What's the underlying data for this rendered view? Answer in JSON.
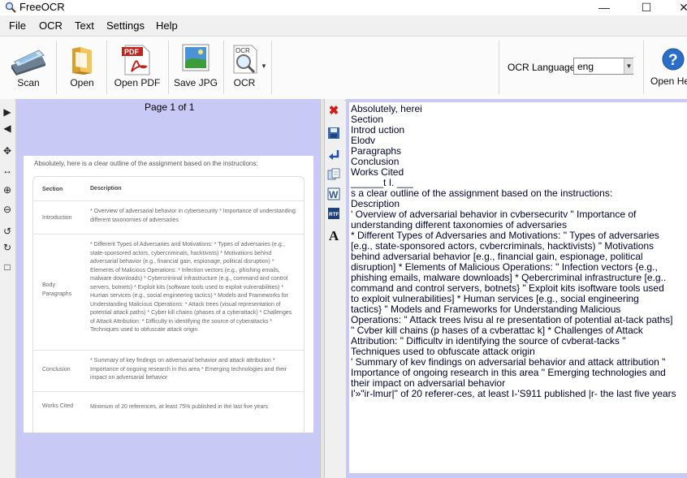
{
  "window": {
    "title": "FreeOCR"
  },
  "menu": [
    "File",
    "OCR",
    "Text",
    "Settings",
    "Help"
  ],
  "toolbar": {
    "scan": "Scan",
    "open": "Open",
    "open_pdf": "Open PDF",
    "save_jpg": "Save JPG",
    "ocr": "OCR",
    "ocr_language_label": "OCR Language:",
    "ocr_language_value": "eng",
    "open_help": "Open He"
  },
  "image_pane": {
    "page_indicator": "Page 1 of 1"
  },
  "document_image": {
    "intro": "Absolutely, here is a clear outline of the assignment based on the instructions:",
    "header": {
      "section": "Section",
      "description": "Description"
    },
    "rows": [
      {
        "section": "Introduction",
        "description": "* Overview of adversarial behavior in cybersecurity * Importance of understanding different taxonomies of adversaries"
      },
      {
        "section": "Body Paragraphs",
        "description": "* Different Types of Adversaries and Motivations: * Types of adversaries (e.g., state-sponsored actors, cybercriminals, hacktivists) * Motivations behind adversarial behavior (e.g., financial gain, espionage, political disruption) * Elements of Malicious Operations: * Infection vectors (e.g., phishing emails, malware downloads) * Cybercriminal infrastructure (e.g., command and control servers, botnets) * Exploit kits (software tools used to exploit vulnerabilities) * Human services (e.g., social engineering tactics) * Models and Frameworks for Understanding Malicious Operations: * Attack trees (visual representation of potential attack paths) * Cyber kill chains (phases of a cyberattack) * Challenges of Attack Attribution: * Difficulty in identifying the source of cyberattacks * Techniques used to obfuscate attack origin"
      },
      {
        "section": "Conclusion",
        "description": "* Summary of key findings on adversarial behavior and attack attribution * Importance of ongoing research in this area * Emerging technologies and their impact on adversarial behavior"
      },
      {
        "section": "Works Cited",
        "description": "Minimum of 20 references, at least 75% published in the last five years"
      }
    ]
  },
  "ocr_text": [
    "Absolutely, herei",
    "Section",
    "Introd uction",
    "Elodv",
    "Paragraphs",
    "Conclusion",
    "Works Cited",
    "______t I. ___",
    "s a clear outline of the assignment based on the instructions:",
    "Description",
    "' Overview of adversarial behavior in cvbersecuritv \" Importance of",
    "understanding different taxonomies of adversaries",
    "* Different Types of Adversaries and Motivations: \" Types of adversaries",
    "[e.g., state-sponsored actors, cvbercriminals, hacktivists) \" Motivations",
    "behind adversarial behavior [e.g., financial gain, espionage, political",
    "disruption] * Elements of Malicious Operations: \" Infection vectors {e.g.,",
    "phishing emails, malware downloads] * Qebercriminal infrastructure [e.g..",
    "command and control servers, botnets} \" Exploit kits isoftware tools used",
    "to exploit vulnerabilities] * Human services [e.g., social engineering",
    "tactics} \" Models and Frameworks for Understanding Malicious",
    "Operations: \" Attack trees lvisu al re presentation of potential at-tack paths]",
    "\" Cvber kill chains (p hases of a cvberattac k] * Challenges of Attack",
    "Attribution: \" Difficultv in identifying the source of cvberat-tacks \"",
    "Techniques used to obfuscate attack origin",
    "' Summary of kev findings on adversarial behavior and attack attribution \"",
    "Importance of ongoing research in this area \" Emerging technologies and",
    "their impact on adversarial behavior",
    "I'»\"ir-lmur|\" of 20 referer-ces, at least I-'S911 published |r- the last five years"
  ]
}
